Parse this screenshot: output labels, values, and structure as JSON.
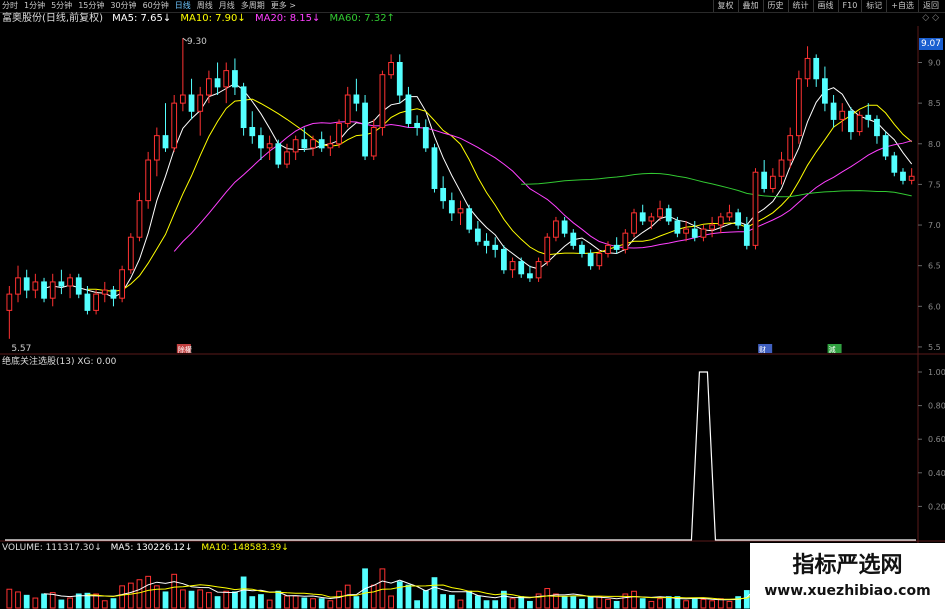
{
  "toolbar": {
    "periods": [
      "分时",
      "1分钟",
      "5分钟",
      "15分钟",
      "30分钟",
      "60分钟",
      "日线",
      "周线",
      "月线",
      "多周期",
      "更多 >"
    ],
    "active_period": "日线",
    "tools": [
      "复权",
      "叠加",
      "历史",
      "统计",
      "画线",
      "F10",
      "标记",
      "+自选",
      "返回"
    ]
  },
  "header": {
    "stock": "富奥股份(日线,前复权)",
    "ma5": "MA5: 7.65↓",
    "ma10": "MA10: 7.90↓",
    "ma20": "MA20: 8.15↓",
    "ma60": "MA60: 7.32↑",
    "ctl": "◇ ◇"
  },
  "colors": {
    "up": "#ff3232",
    "down": "#54ffff",
    "ma5": "#ffffff",
    "ma10": "#ffff00",
    "ma20": "#ff40ff",
    "ma60": "#32c832",
    "grid": "#5a1a1a"
  },
  "price_tag": "9.07",
  "annotations": {
    "high": "9.30",
    "low": "5.57",
    "event1": "除權",
    "event2": "财",
    "event3": "減"
  },
  "price_axis": [
    "9.0",
    "8.5",
    "8.0",
    "7.5",
    "7.0",
    "6.5",
    "6.0",
    "5.5"
  ],
  "indicator": {
    "title": "绝底关注选股(13) XG: 0.00",
    "axis": [
      "1.00",
      "0.80",
      "0.60",
      "0.40",
      "0.20"
    ],
    "signal_at": 80,
    "signal_value": 1.0
  },
  "volume": {
    "title_vol": "VOLUME: 111317.30↓",
    "title_ma5": "MA5: 130226.12↓",
    "title_ma10": "MA10: 148583.39↓"
  },
  "watermark": {
    "title": "指标严选网",
    "url": "www.xuezhibiao.com"
  },
  "chart_data": {
    "type": "candlestick",
    "title": "富奥股份(日线,前复权)",
    "ylim": [
      5.45,
      9.4
    ],
    "candles": [
      [
        5.95,
        6.25,
        5.6,
        6.15
      ],
      [
        6.15,
        6.5,
        6.05,
        6.35
      ],
      [
        6.35,
        6.45,
        6.1,
        6.2
      ],
      [
        6.2,
        6.4,
        6.1,
        6.3
      ],
      [
        6.3,
        6.35,
        6.05,
        6.1
      ],
      [
        6.1,
        6.4,
        6.0,
        6.3
      ],
      [
        6.3,
        6.45,
        6.15,
        6.25
      ],
      [
        6.25,
        6.4,
        6.1,
        6.35
      ],
      [
        6.35,
        6.4,
        6.1,
        6.15
      ],
      [
        6.15,
        6.25,
        5.9,
        5.95
      ],
      [
        5.95,
        6.2,
        5.9,
        6.15
      ],
      [
        6.15,
        6.3,
        6.05,
        6.2
      ],
      [
        6.2,
        6.25,
        6.0,
        6.1
      ],
      [
        6.1,
        6.5,
        6.05,
        6.45
      ],
      [
        6.45,
        6.9,
        6.4,
        6.85
      ],
      [
        6.85,
        7.4,
        6.8,
        7.3
      ],
      [
        7.3,
        7.9,
        7.2,
        7.8
      ],
      [
        7.8,
        8.2,
        7.6,
        8.1
      ],
      [
        8.1,
        8.5,
        7.9,
        7.95
      ],
      [
        7.95,
        8.6,
        7.9,
        8.5
      ],
      [
        8.5,
        9.3,
        8.4,
        8.6
      ],
      [
        8.6,
        8.8,
        8.3,
        8.4
      ],
      [
        8.4,
        8.7,
        8.1,
        8.6
      ],
      [
        8.6,
        8.9,
        8.5,
        8.8
      ],
      [
        8.8,
        9.0,
        8.6,
        8.7
      ],
      [
        8.7,
        9.0,
        8.5,
        8.9
      ],
      [
        8.9,
        9.05,
        8.6,
        8.7
      ],
      [
        8.7,
        8.75,
        8.1,
        8.2
      ],
      [
        8.2,
        8.4,
        8.0,
        8.1
      ],
      [
        8.1,
        8.2,
        7.8,
        7.95
      ],
      [
        7.95,
        8.1,
        7.8,
        8.0
      ],
      [
        8.0,
        8.05,
        7.7,
        7.75
      ],
      [
        7.75,
        8.0,
        7.7,
        7.9
      ],
      [
        7.9,
        8.1,
        7.8,
        8.05
      ],
      [
        8.05,
        8.2,
        7.9,
        7.95
      ],
      [
        7.95,
        8.1,
        7.85,
        8.05
      ],
      [
        8.05,
        8.15,
        7.9,
        7.95
      ],
      [
        7.95,
        8.1,
        7.85,
        8.0
      ],
      [
        8.0,
        8.3,
        7.95,
        8.25
      ],
      [
        8.25,
        8.7,
        8.2,
        8.6
      ],
      [
        8.6,
        8.8,
        8.4,
        8.5
      ],
      [
        8.5,
        8.6,
        7.8,
        7.85
      ],
      [
        7.85,
        8.3,
        7.8,
        8.2
      ],
      [
        8.2,
        8.9,
        8.1,
        8.85
      ],
      [
        8.85,
        9.1,
        8.8,
        9.0
      ],
      [
        9.0,
        9.1,
        8.5,
        8.6
      ],
      [
        8.6,
        8.7,
        8.2,
        8.25
      ],
      [
        8.25,
        8.35,
        8.1,
        8.2
      ],
      [
        8.2,
        8.3,
        7.9,
        7.95
      ],
      [
        7.95,
        8.0,
        7.4,
        7.45
      ],
      [
        7.45,
        7.6,
        7.2,
        7.3
      ],
      [
        7.3,
        7.4,
        7.05,
        7.15
      ],
      [
        7.15,
        7.3,
        7.0,
        7.2
      ],
      [
        7.2,
        7.25,
        6.9,
        6.95
      ],
      [
        6.95,
        7.05,
        6.75,
        6.8
      ],
      [
        6.8,
        6.9,
        6.65,
        6.75
      ],
      [
        6.75,
        6.85,
        6.6,
        6.7
      ],
      [
        6.7,
        6.75,
        6.4,
        6.45
      ],
      [
        6.45,
        6.6,
        6.35,
        6.55
      ],
      [
        6.55,
        6.6,
        6.35,
        6.4
      ],
      [
        6.4,
        6.5,
        6.3,
        6.35
      ],
      [
        6.35,
        6.6,
        6.3,
        6.55
      ],
      [
        6.55,
        6.9,
        6.5,
        6.85
      ],
      [
        6.85,
        7.1,
        6.8,
        7.05
      ],
      [
        7.05,
        7.1,
        6.85,
        6.9
      ],
      [
        6.9,
        6.95,
        6.7,
        6.75
      ],
      [
        6.75,
        6.8,
        6.6,
        6.65
      ],
      [
        6.65,
        6.7,
        6.45,
        6.5
      ],
      [
        6.5,
        6.7,
        6.45,
        6.65
      ],
      [
        6.65,
        6.8,
        6.6,
        6.75
      ],
      [
        6.75,
        6.85,
        6.65,
        6.7
      ],
      [
        6.7,
        6.95,
        6.65,
        6.9
      ],
      [
        6.9,
        7.2,
        6.85,
        7.15
      ],
      [
        7.15,
        7.25,
        7.0,
        7.05
      ],
      [
        7.05,
        7.15,
        6.95,
        7.1
      ],
      [
        7.1,
        7.3,
        7.05,
        7.2
      ],
      [
        7.2,
        7.25,
        7.0,
        7.05
      ],
      [
        7.05,
        7.1,
        6.85,
        6.9
      ],
      [
        6.9,
        7.05,
        6.8,
        6.95
      ],
      [
        6.95,
        7.05,
        6.8,
        6.85
      ],
      [
        6.85,
        7.0,
        6.8,
        6.95
      ],
      [
        6.95,
        7.1,
        6.85,
        7.0
      ],
      [
        7.0,
        7.15,
        6.9,
        7.1
      ],
      [
        7.1,
        7.25,
        7.05,
        7.15
      ],
      [
        7.15,
        7.2,
        6.95,
        7.0
      ],
      [
        7.0,
        7.1,
        6.7,
        6.75
      ],
      [
        6.75,
        7.7,
        6.7,
        7.65
      ],
      [
        7.65,
        7.8,
        7.4,
        7.45
      ],
      [
        7.45,
        7.7,
        7.4,
        7.6
      ],
      [
        7.6,
        7.9,
        7.5,
        7.8
      ],
      [
        7.8,
        8.2,
        7.7,
        8.1
      ],
      [
        8.1,
        8.9,
        8.0,
        8.8
      ],
      [
        8.8,
        9.2,
        8.7,
        9.05
      ],
      [
        9.05,
        9.1,
        8.7,
        8.8
      ],
      [
        8.8,
        8.95,
        8.4,
        8.5
      ],
      [
        8.5,
        8.6,
        8.2,
        8.3
      ],
      [
        8.3,
        8.5,
        8.15,
        8.4
      ],
      [
        8.4,
        8.45,
        8.05,
        8.15
      ],
      [
        8.15,
        8.4,
        8.1,
        8.35
      ],
      [
        8.35,
        8.5,
        8.2,
        8.3
      ],
      [
        8.3,
        8.35,
        8.0,
        8.1
      ],
      [
        8.1,
        8.15,
        7.8,
        7.85
      ],
      [
        7.85,
        7.9,
        7.6,
        7.65
      ],
      [
        7.65,
        7.7,
        7.5,
        7.55
      ],
      [
        7.55,
        7.7,
        7.5,
        7.6
      ]
    ],
    "ma_periods": [
      5,
      10,
      20,
      60
    ],
    "volume_unit": "手"
  }
}
